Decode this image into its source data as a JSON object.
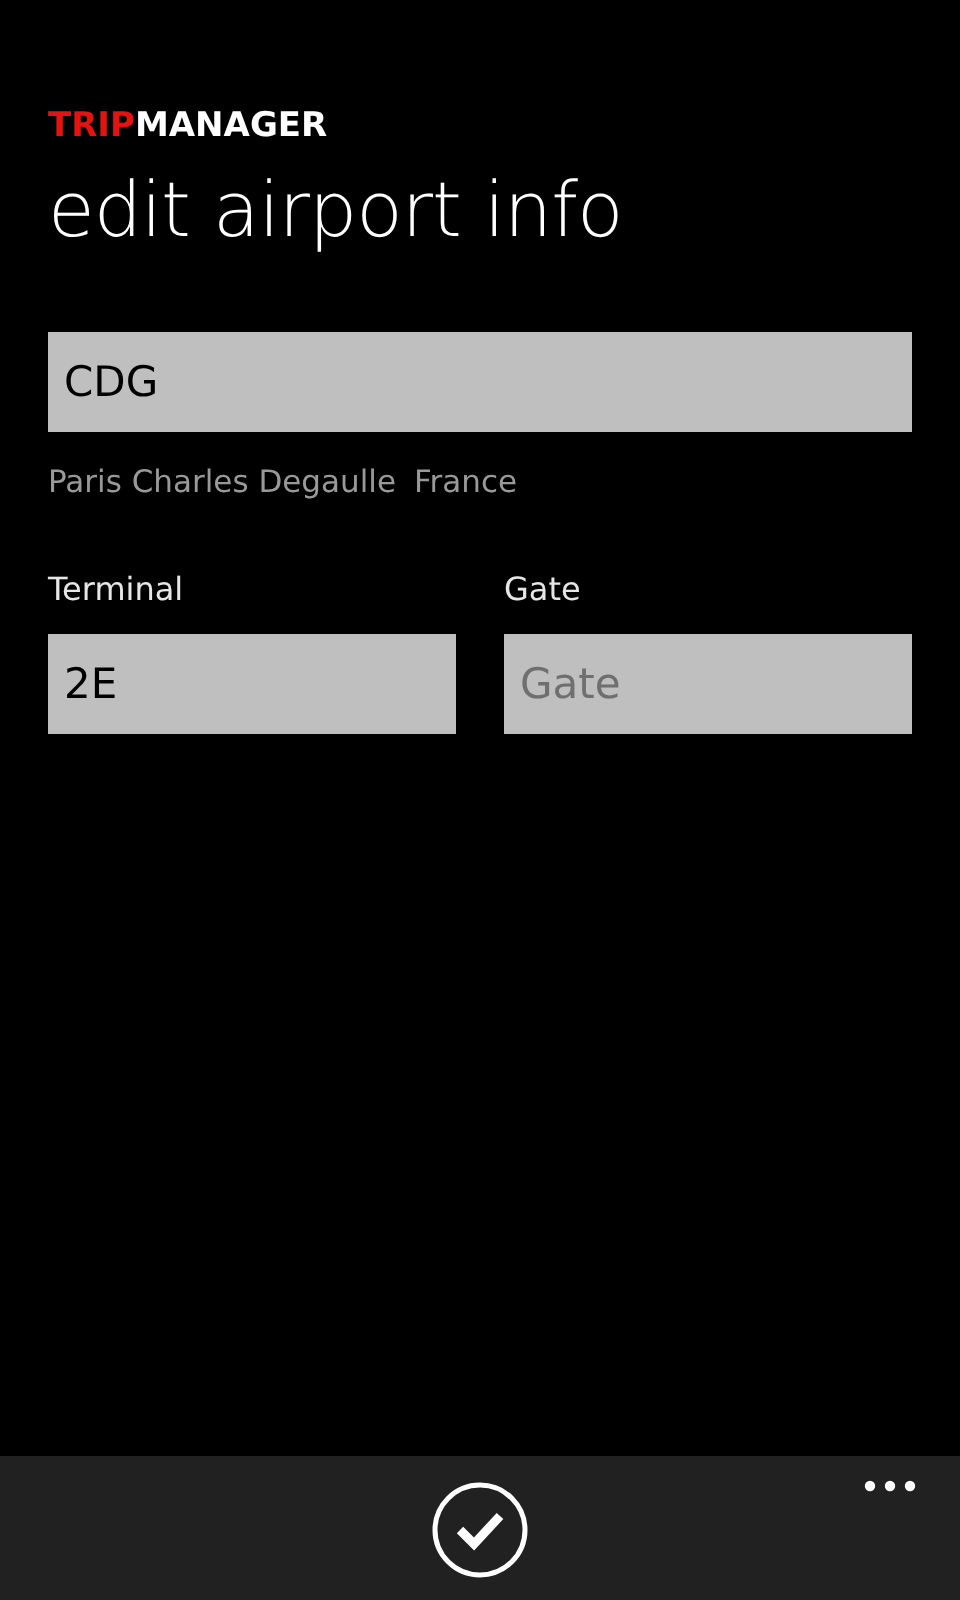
{
  "app_logo": [
    {
      "text": "TRIP",
      "color": "#e3140f"
    },
    {
      "text": "MANAGER",
      "color": "#ffffff"
    }
  ],
  "page_title": "edit airport info",
  "airport_code": {
    "value": "CDG"
  },
  "airport_details": {
    "name": "Paris Charles Degaulle",
    "country": "France"
  },
  "fields": [
    {
      "label": "Terminal",
      "value": "2E"
    },
    {
      "label": "Gate",
      "placeholder": "Gate"
    }
  ],
  "app_bar": {
    "confirm_button": true,
    "more_button": true
  }
}
